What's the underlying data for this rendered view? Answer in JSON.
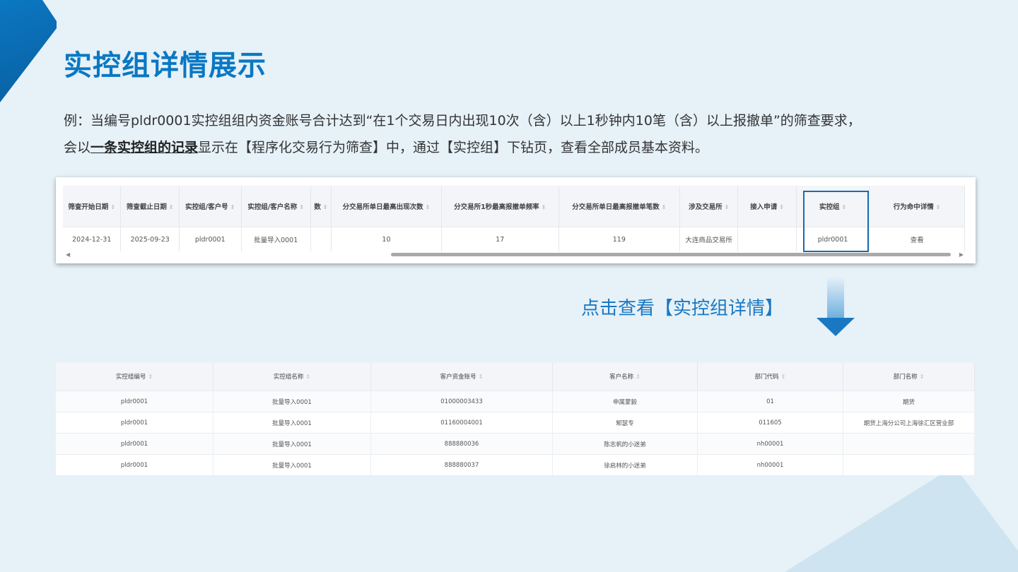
{
  "title": "实控组详情展示",
  "desc": {
    "line1": "例：当编号pldr0001实控组组内资金账号合计达到“在1个交易日内出现10次（含）以上1秒钟内10笔（含）以上报撤单”的筛查要求，",
    "line2_prefix": "会以",
    "line2_bold": "一条实控组的记录",
    "line2_suffix": "显示在【程序化交易行为筛查】中，通过【实控组】下钻页，查看全部成员基本资料。"
  },
  "table1": {
    "headers": [
      "筛查开始日期",
      "筛查截止日期",
      "实控组/客户号",
      "实控组/客户名称",
      "数",
      "分交易所单日最高出现次数",
      "分交易所1秒最高报撤单频率",
      "分交易所单日最高报撤单笔数",
      "涉及交易所",
      "接入申请",
      "实控组",
      "行为命中详情"
    ],
    "row": [
      "2024-12-31",
      "2025-09-23",
      "pldr0001",
      "批量导入0001",
      "",
      "10",
      "17",
      "119",
      "大连商品交易所",
      "",
      "pldr0001",
      "查看"
    ]
  },
  "hint": "点击查看【实控组详情】",
  "table2": {
    "headers": [
      "实控组编号",
      "实控组名称",
      "客户资金账号",
      "客户名称",
      "部门代码",
      "部门名称"
    ],
    "rows": [
      [
        "pldr0001",
        "批量导入0001",
        "01000003433",
        "申属蒙毅",
        "01",
        "期货"
      ],
      [
        "pldr0001",
        "批量导入0001",
        "01160004001",
        "邾瑟专",
        "011605",
        "期货上海分公司上海徐汇区营业部"
      ],
      [
        "pldr0001",
        "批量导入0001",
        "888880036",
        "陈志帆的小迷弟",
        "nh00001",
        ""
      ],
      [
        "pldr0001",
        "批量导入0001",
        "888880037",
        "徐启林的小迷弟",
        "nh00001",
        ""
      ]
    ]
  },
  "colors": {
    "accent": "#0a78c3",
    "link": "#2d8cf0",
    "background": "#e6f1f8"
  },
  "icons": {
    "sort": "sort-icon",
    "arrow": "down-arrow-icon"
  }
}
